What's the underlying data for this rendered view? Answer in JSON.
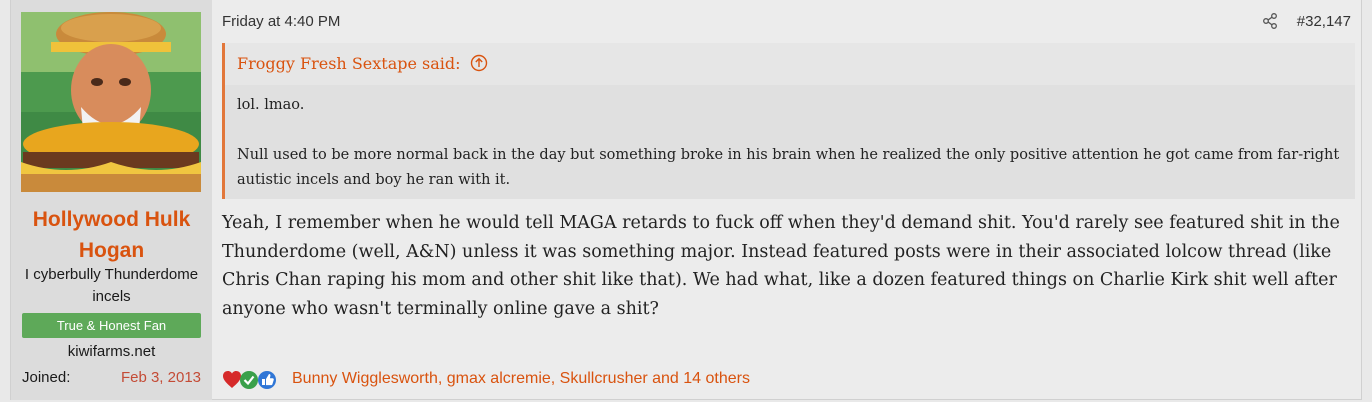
{
  "user": {
    "name": "Hollywood Hulk Hogan",
    "title": "I cyberbully Thunderdome incels",
    "banner": "True & Honest Fan",
    "site": "kiwifarms.net",
    "joined_label": "Joined:",
    "joined_value": "Feb 3, 2013"
  },
  "post": {
    "date": "Friday at 4:40 PM",
    "number": "#32,147",
    "quote": {
      "author": "Froggy Fresh Sextape said:",
      "lines": [
        "lol. lmao.",
        "Null used to be more normal back in the day but something broke in his brain when he realized the only positive attention he got came from far-right autistic incels and boy he ran with it."
      ]
    },
    "body": "Yeah, I remember when he would tell MAGA retards to fuck off when they'd demand shit. You'd rarely see featured shit in the Thunderdome (well, A&N) unless it was something major. Instead featured posts were in their associated lolcow thread (like Chris Chan raping his mom and other shit like that). We had what, like a dozen featured things on Charlie Kirk shit well after anyone who wasn't terminally online gave a shit?"
  },
  "reactions": {
    "icons": [
      "heart-icon",
      "check-icon",
      "thumbs-up-icon"
    ],
    "text": "Bunny Wigglesworth, gmax alcremie, Skullcrusher and 14 others"
  },
  "colors": {
    "accent": "#d9530f",
    "banner_bg": "#5ea959",
    "quote_border": "#e2773a",
    "joined_value": "#c44b36"
  }
}
